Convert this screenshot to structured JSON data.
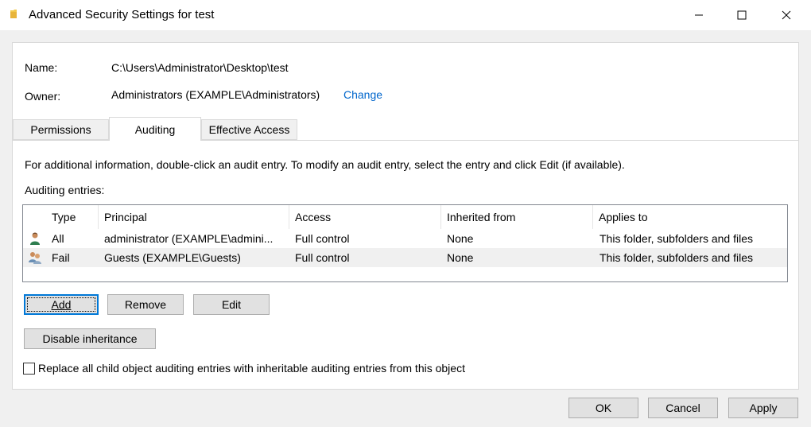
{
  "window": {
    "title": "Advanced Security Settings for test",
    "folder_icon": "folder-icon",
    "minimize_icon": "minimize-icon",
    "maximize_icon": "maximize-icon",
    "close_icon": "close-icon"
  },
  "info": {
    "name_label": "Name:",
    "name_value": "C:\\Users\\Administrator\\Desktop\\test",
    "owner_label": "Owner:",
    "owner_value": "Administrators (EXAMPLE\\Administrators)",
    "change_link": "Change",
    "link_color": "#0066cc"
  },
  "tabs": [
    {
      "label": "Permissions",
      "active": false
    },
    {
      "label": "Auditing",
      "active": true
    },
    {
      "label": "Effective Access",
      "active": false
    }
  ],
  "auditing": {
    "instructions": "For additional information, double-click an audit entry. To modify an audit entry, select the entry and click Edit (if available).",
    "entries_label": "Auditing entries:",
    "columns": [
      "Type",
      "Principal",
      "Access",
      "Inherited from",
      "Applies to"
    ],
    "rows": [
      {
        "icon": "user-icon",
        "type": "All",
        "principal": "administrator (EXAMPLE\\admini...",
        "access": "Full control",
        "inherited": "None",
        "applies": "This folder, subfolders and files",
        "selected": false
      },
      {
        "icon": "group-icon",
        "type": "Fail",
        "principal": "Guests (EXAMPLE\\Guests)",
        "access": "Full control",
        "inherited": "None",
        "applies": "This folder, subfolders and files",
        "selected": true
      }
    ],
    "add_button": "Add",
    "remove_button": "Remove",
    "edit_button": "Edit",
    "disable_inheritance_button": "Disable inheritance",
    "replace_checkbox_label": "Replace all child object auditing entries with inheritable auditing entries from this object",
    "replace_checked": false
  },
  "footer": {
    "ok_button": "OK",
    "cancel_button": "Cancel",
    "apply_button": "Apply"
  },
  "colors": {
    "accent": "#0078d7",
    "selected_row": "#f0f0f0"
  }
}
